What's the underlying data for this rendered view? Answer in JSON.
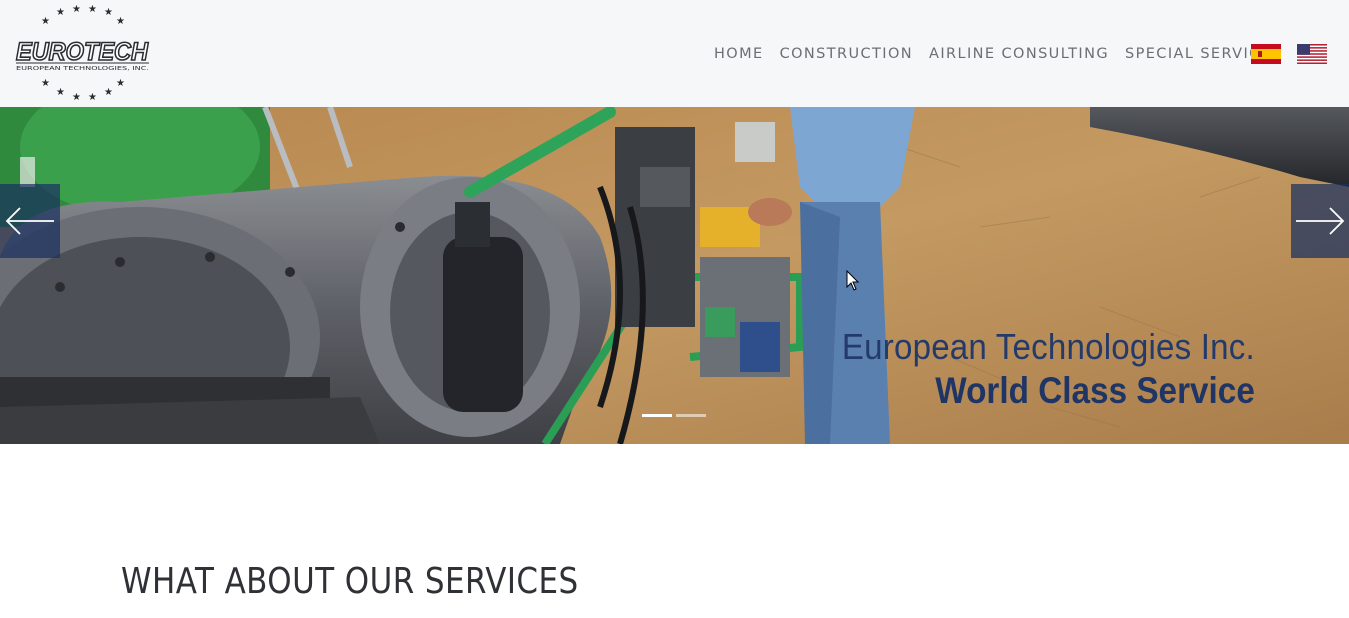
{
  "brand": {
    "logo_text": "EUROTECH",
    "logo_subtitle": "EUROPEAN TECHNOLOGIES, INC."
  },
  "nav": {
    "items": [
      {
        "label": "HOME"
      },
      {
        "label": "CONSTRUCTION"
      },
      {
        "label": "AIRLINE CONSULTING"
      },
      {
        "label": "SPECIAL SERVICES"
      }
    ],
    "flags": [
      "spain-flag-icon",
      "usa-flag-icon"
    ]
  },
  "hero": {
    "caption_line1": "European Technologies Inc.",
    "caption_line2": "World Class Service",
    "prev_icon": "arrow-left-icon",
    "next_icon": "arrow-right-icon",
    "slides_total": 2,
    "active_slide": 1
  },
  "services": {
    "heading": "WHAT ABOUT OUR SERVICES"
  },
  "colors": {
    "header_bg": "#f6f7f9",
    "nav_text": "#6b6e72",
    "caption_blue": "#1f3566",
    "arrow_bg": "#1b3060"
  }
}
